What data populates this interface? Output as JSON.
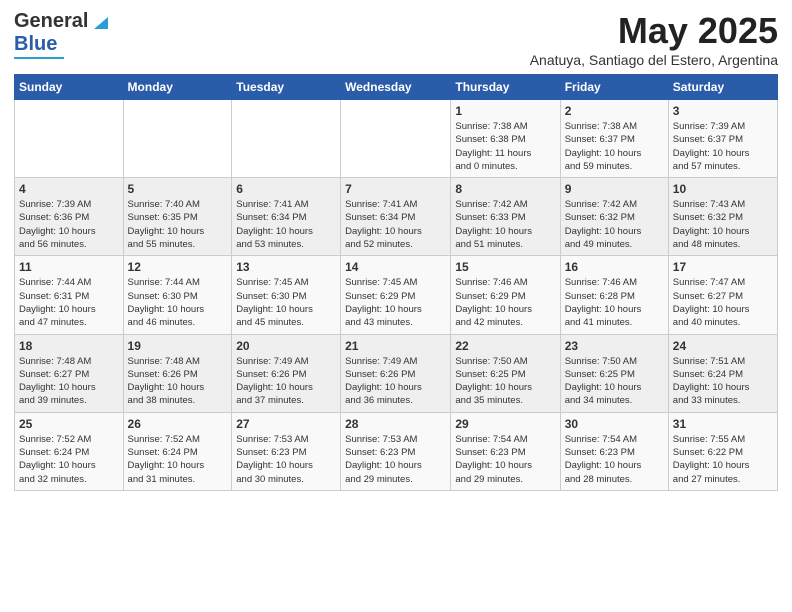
{
  "header": {
    "logo_general": "General",
    "logo_blue": "Blue",
    "month_title": "May 2025",
    "subtitle": "Anatuya, Santiago del Estero, Argentina"
  },
  "days_of_week": [
    "Sunday",
    "Monday",
    "Tuesday",
    "Wednesday",
    "Thursday",
    "Friday",
    "Saturday"
  ],
  "weeks": [
    [
      {
        "num": "",
        "info": ""
      },
      {
        "num": "",
        "info": ""
      },
      {
        "num": "",
        "info": ""
      },
      {
        "num": "",
        "info": ""
      },
      {
        "num": "1",
        "info": "Sunrise: 7:38 AM\nSunset: 6:38 PM\nDaylight: 11 hours\nand 0 minutes."
      },
      {
        "num": "2",
        "info": "Sunrise: 7:38 AM\nSunset: 6:37 PM\nDaylight: 10 hours\nand 59 minutes."
      },
      {
        "num": "3",
        "info": "Sunrise: 7:39 AM\nSunset: 6:37 PM\nDaylight: 10 hours\nand 57 minutes."
      }
    ],
    [
      {
        "num": "4",
        "info": "Sunrise: 7:39 AM\nSunset: 6:36 PM\nDaylight: 10 hours\nand 56 minutes."
      },
      {
        "num": "5",
        "info": "Sunrise: 7:40 AM\nSunset: 6:35 PM\nDaylight: 10 hours\nand 55 minutes."
      },
      {
        "num": "6",
        "info": "Sunrise: 7:41 AM\nSunset: 6:34 PM\nDaylight: 10 hours\nand 53 minutes."
      },
      {
        "num": "7",
        "info": "Sunrise: 7:41 AM\nSunset: 6:34 PM\nDaylight: 10 hours\nand 52 minutes."
      },
      {
        "num": "8",
        "info": "Sunrise: 7:42 AM\nSunset: 6:33 PM\nDaylight: 10 hours\nand 51 minutes."
      },
      {
        "num": "9",
        "info": "Sunrise: 7:42 AM\nSunset: 6:32 PM\nDaylight: 10 hours\nand 49 minutes."
      },
      {
        "num": "10",
        "info": "Sunrise: 7:43 AM\nSunset: 6:32 PM\nDaylight: 10 hours\nand 48 minutes."
      }
    ],
    [
      {
        "num": "11",
        "info": "Sunrise: 7:44 AM\nSunset: 6:31 PM\nDaylight: 10 hours\nand 47 minutes."
      },
      {
        "num": "12",
        "info": "Sunrise: 7:44 AM\nSunset: 6:30 PM\nDaylight: 10 hours\nand 46 minutes."
      },
      {
        "num": "13",
        "info": "Sunrise: 7:45 AM\nSunset: 6:30 PM\nDaylight: 10 hours\nand 45 minutes."
      },
      {
        "num": "14",
        "info": "Sunrise: 7:45 AM\nSunset: 6:29 PM\nDaylight: 10 hours\nand 43 minutes."
      },
      {
        "num": "15",
        "info": "Sunrise: 7:46 AM\nSunset: 6:29 PM\nDaylight: 10 hours\nand 42 minutes."
      },
      {
        "num": "16",
        "info": "Sunrise: 7:46 AM\nSunset: 6:28 PM\nDaylight: 10 hours\nand 41 minutes."
      },
      {
        "num": "17",
        "info": "Sunrise: 7:47 AM\nSunset: 6:27 PM\nDaylight: 10 hours\nand 40 minutes."
      }
    ],
    [
      {
        "num": "18",
        "info": "Sunrise: 7:48 AM\nSunset: 6:27 PM\nDaylight: 10 hours\nand 39 minutes."
      },
      {
        "num": "19",
        "info": "Sunrise: 7:48 AM\nSunset: 6:26 PM\nDaylight: 10 hours\nand 38 minutes."
      },
      {
        "num": "20",
        "info": "Sunrise: 7:49 AM\nSunset: 6:26 PM\nDaylight: 10 hours\nand 37 minutes."
      },
      {
        "num": "21",
        "info": "Sunrise: 7:49 AM\nSunset: 6:26 PM\nDaylight: 10 hours\nand 36 minutes."
      },
      {
        "num": "22",
        "info": "Sunrise: 7:50 AM\nSunset: 6:25 PM\nDaylight: 10 hours\nand 35 minutes."
      },
      {
        "num": "23",
        "info": "Sunrise: 7:50 AM\nSunset: 6:25 PM\nDaylight: 10 hours\nand 34 minutes."
      },
      {
        "num": "24",
        "info": "Sunrise: 7:51 AM\nSunset: 6:24 PM\nDaylight: 10 hours\nand 33 minutes."
      }
    ],
    [
      {
        "num": "25",
        "info": "Sunrise: 7:52 AM\nSunset: 6:24 PM\nDaylight: 10 hours\nand 32 minutes."
      },
      {
        "num": "26",
        "info": "Sunrise: 7:52 AM\nSunset: 6:24 PM\nDaylight: 10 hours\nand 31 minutes."
      },
      {
        "num": "27",
        "info": "Sunrise: 7:53 AM\nSunset: 6:23 PM\nDaylight: 10 hours\nand 30 minutes."
      },
      {
        "num": "28",
        "info": "Sunrise: 7:53 AM\nSunset: 6:23 PM\nDaylight: 10 hours\nand 29 minutes."
      },
      {
        "num": "29",
        "info": "Sunrise: 7:54 AM\nSunset: 6:23 PM\nDaylight: 10 hours\nand 29 minutes."
      },
      {
        "num": "30",
        "info": "Sunrise: 7:54 AM\nSunset: 6:23 PM\nDaylight: 10 hours\nand 28 minutes."
      },
      {
        "num": "31",
        "info": "Sunrise: 7:55 AM\nSunset: 6:22 PM\nDaylight: 10 hours\nand 27 minutes."
      }
    ]
  ]
}
